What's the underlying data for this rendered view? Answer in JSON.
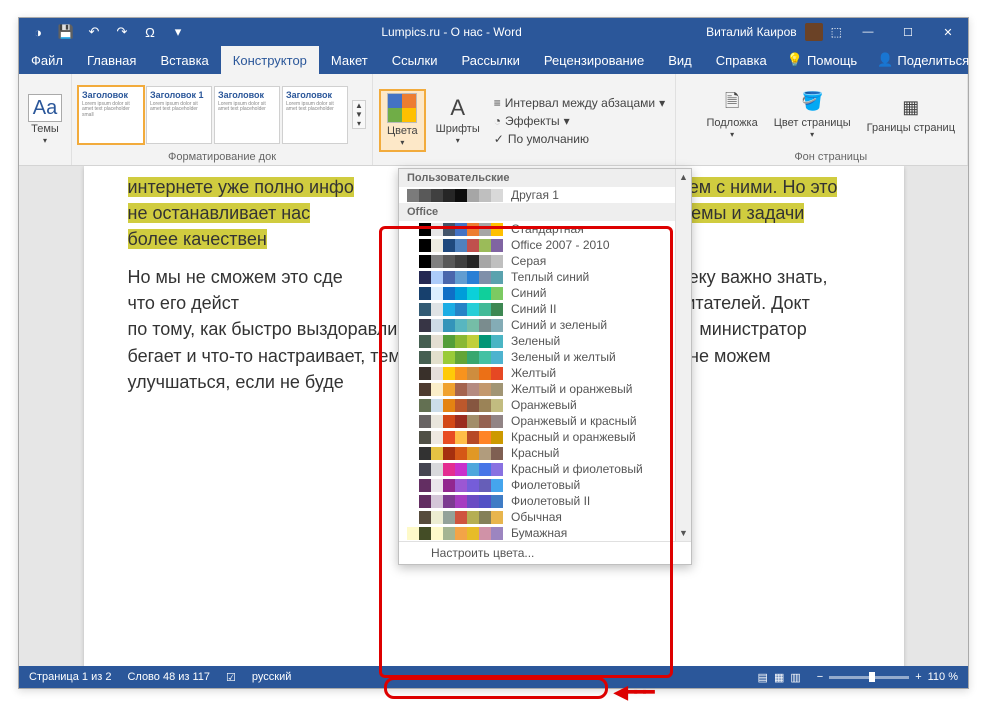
{
  "titlebar": {
    "title": "Lumpics.ru - О нас - Word",
    "user": "Виталий Каиров"
  },
  "tabs": {
    "file": "Файл",
    "home": "Главная",
    "insert": "Вставка",
    "design": "Конструктор",
    "layout": "Макет",
    "refs": "Ссылки",
    "mail": "Рассылки",
    "review": "Рецензирование",
    "view": "Вид",
    "help": "Справка",
    "tell": "Помощь",
    "share": "Поделиться"
  },
  "ribbon": {
    "themes": "Темы",
    "gallery": {
      "h": "Заголовок",
      "h1": "Заголовок 1"
    },
    "formatting_group": "Форматирование док",
    "colors": "Цвета",
    "fonts": "Шрифты",
    "para_spacing": "Интервал между абзацами",
    "effects": "Эффекты",
    "default": "По умолчанию",
    "watermark": "Подложка",
    "page_color": "Цвет страницы",
    "borders": "Границы страниц",
    "page_bg_group": "Фон страницы"
  },
  "document": {
    "p1a": "интернете уже полно инфо",
    "p1b": "проблем с ними. Но это не останавливает нас",
    "p1c": "ать многие проблемы и задачи более качествен",
    "p2": "Но мы не сможем это сде                                                обому человеку важно знать, что его дейст                                         о своей работе по отзывам читателей. Докт                                              по тому, как быстро выздоравливают его пац                                       министратор бегает и что-то настраивает, тем                                              к и мы не можем улучшаться, если не буде"
  },
  "colors_menu": {
    "custom_section": "Пользовательские",
    "office_section": "Office",
    "customize": "Настроить цвета...",
    "custom": [
      {
        "name": "Другая 1",
        "colors": [
          "#7b7b7b",
          "#595959",
          "#404040",
          "#262626",
          "#0d0d0d",
          "#a6a6a6",
          "#bfbfbf",
          "#d9d9d9"
        ]
      }
    ],
    "office": [
      {
        "name": "Стандартная",
        "colors": [
          "#ffffff",
          "#000000",
          "#e7e6e6",
          "#44546a",
          "#4472c4",
          "#ed7d31",
          "#a5a5a5",
          "#ffc000"
        ]
      },
      {
        "name": "Office 2007 - 2010",
        "colors": [
          "#ffffff",
          "#000000",
          "#eeece1",
          "#1f497d",
          "#4f81bd",
          "#c0504d",
          "#9bbb59",
          "#8064a2"
        ]
      },
      {
        "name": "Серая",
        "colors": [
          "#ffffff",
          "#000000",
          "#808080",
          "#595959",
          "#404040",
          "#262626",
          "#a6a6a6",
          "#bfbfbf"
        ]
      },
      {
        "name": "Теплый синий",
        "colors": [
          "#ffffff",
          "#242852",
          "#accbf9",
          "#4a66ac",
          "#629dd1",
          "#297fd5",
          "#7f8fa9",
          "#5aa2ae"
        ]
      },
      {
        "name": "Синий",
        "colors": [
          "#ffffff",
          "#17406d",
          "#dbefff",
          "#0f6fc6",
          "#009dd9",
          "#0bd0d9",
          "#10cf9b",
          "#7cca62"
        ]
      },
      {
        "name": "Синий II",
        "colors": [
          "#ffffff",
          "#335b74",
          "#dfe3e5",
          "#1cade4",
          "#2683c6",
          "#27ced7",
          "#42ba97",
          "#3e8853"
        ]
      },
      {
        "name": "Синий и зеленый",
        "colors": [
          "#ffffff",
          "#373545",
          "#cedbe6",
          "#3494ba",
          "#58b6c0",
          "#75bda7",
          "#7a8c8e",
          "#84acb6"
        ]
      },
      {
        "name": "Зеленый",
        "colors": [
          "#ffffff",
          "#455f51",
          "#e3ded1",
          "#549e39",
          "#8ab833",
          "#c0cf3a",
          "#029676",
          "#4ab5c4"
        ]
      },
      {
        "name": "Зеленый и желтый",
        "colors": [
          "#ffffff",
          "#455f51",
          "#e2dfcc",
          "#99cb38",
          "#63a537",
          "#37a76f",
          "#44c1a3",
          "#4eb3cf"
        ]
      },
      {
        "name": "Желтый",
        "colors": [
          "#ffffff",
          "#39302a",
          "#e5dedb",
          "#ffca08",
          "#f8931d",
          "#ce8d3e",
          "#ec7016",
          "#e64823"
        ]
      },
      {
        "name": "Желтый и оранжевый",
        "colors": [
          "#ffffff",
          "#4e3b30",
          "#fbeec9",
          "#f0a22e",
          "#a5644e",
          "#b58b80",
          "#c3986d",
          "#a19574"
        ]
      },
      {
        "name": "Оранжевый",
        "colors": [
          "#ffffff",
          "#637052",
          "#ccddea",
          "#e48312",
          "#bd582c",
          "#865640",
          "#9b8357",
          "#c2bc80"
        ]
      },
      {
        "name": "Оранжевый и красный",
        "colors": [
          "#ffffff",
          "#696464",
          "#e9e5dc",
          "#d34817",
          "#9b2d1f",
          "#a28e6a",
          "#956251",
          "#918485"
        ]
      },
      {
        "name": "Красный и оранжевый",
        "colors": [
          "#ffffff",
          "#505046",
          "#eee8e0",
          "#e84c22",
          "#ffbd47",
          "#b64926",
          "#ff8427",
          "#cc9900"
        ]
      },
      {
        "name": "Красный",
        "colors": [
          "#ffffff",
          "#323232",
          "#e5c243",
          "#a5300f",
          "#d55816",
          "#e19825",
          "#b19c7d",
          "#7f5f52"
        ]
      },
      {
        "name": "Красный и фиолетовый",
        "colors": [
          "#ffffff",
          "#454551",
          "#d8d9dc",
          "#e32d91",
          "#c830cc",
          "#4ea6dc",
          "#4775e7",
          "#8971e1"
        ]
      },
      {
        "name": "Фиолетовый",
        "colors": [
          "#ffffff",
          "#632e62",
          "#eae5eb",
          "#92278f",
          "#9b57d3",
          "#755dd9",
          "#665eb8",
          "#45a5ed"
        ]
      },
      {
        "name": "Фиолетовый II",
        "colors": [
          "#ffffff",
          "#632e62",
          "#d4c6d8",
          "#7c3b90",
          "#a63cc1",
          "#6a4cc3",
          "#5251c5",
          "#3f7cc5"
        ]
      },
      {
        "name": "Обычная",
        "colors": [
          "#ffffff",
          "#564b3c",
          "#ecedd1",
          "#93a299",
          "#cf543f",
          "#b5ae53",
          "#848058",
          "#e8b54d"
        ]
      },
      {
        "name": "Бумажная",
        "colors": [
          "#fefac9",
          "#444d26",
          "#fefac9",
          "#a5b592",
          "#f3a447",
          "#e7bc29",
          "#d092a7",
          "#9c85c0"
        ]
      }
    ]
  },
  "statusbar": {
    "page": "Страница 1 из 2",
    "words": "Слово 48 из 117",
    "lang": "русский",
    "zoom": "110 %"
  }
}
